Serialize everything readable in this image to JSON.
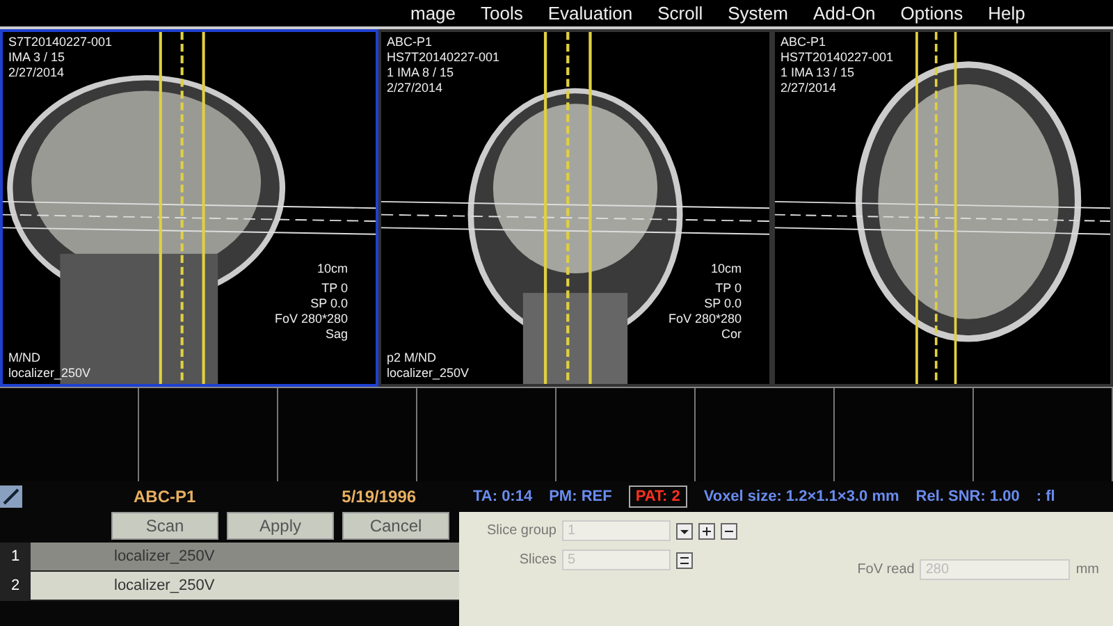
{
  "menu": [
    "mage",
    "Tools",
    "Evaluation",
    "Scroll",
    "System",
    "Add-On",
    "Options",
    "Help"
  ],
  "viewports": [
    {
      "kind": "sagittal",
      "active": true,
      "header": [
        "S7T20140227-001",
        "IMA 3 / 15",
        "2/27/2014"
      ],
      "scale": "10cm",
      "info": [
        "TP 0",
        "SP 0.0",
        "FoV 280*280",
        "Sag"
      ],
      "mode": "M/ND",
      "series": "localizer_250V"
    },
    {
      "kind": "coronal",
      "active": false,
      "header": [
        "ABC-P1",
        "HS7T20140227-001",
        "1 IMA 8 / 15",
        "2/27/2014"
      ],
      "scale": "10cm",
      "info": [
        "TP 0",
        "SP 0.0",
        "FoV 280*280",
        "Cor"
      ],
      "mode": "p2 M/ND",
      "series": "localizer_250V"
    },
    {
      "kind": "axial",
      "active": false,
      "header": [
        "ABC-P1",
        "HS7T20140227-001",
        "1 IMA 13 / 15",
        "2/27/2014"
      ]
    }
  ],
  "patient": "ABC-P1",
  "birth_date": "5/19/1996",
  "status": {
    "ta": "TA: 0:14",
    "pm": "PM: REF",
    "pat": "PAT: 2",
    "voxel": "Voxel size: 1.2×1.1×3.0 mm",
    "snr": "Rel. SNR: 1.00",
    "mode": ": fl"
  },
  "buttons": [
    "Scan",
    "Apply",
    "Cancel"
  ],
  "protocols": [
    {
      "number": "1",
      "name": "localizer_250V",
      "selected": false
    },
    {
      "number": "2",
      "name": "localizer_250V",
      "selected": true
    }
  ],
  "params": [
    {
      "label": "Slice group",
      "value": "1",
      "kind": "group"
    },
    {
      "label": "Slices",
      "value": "5",
      "kind": "count"
    }
  ],
  "fov": {
    "label": "FoV read",
    "value": "280",
    "unit": "mm"
  }
}
